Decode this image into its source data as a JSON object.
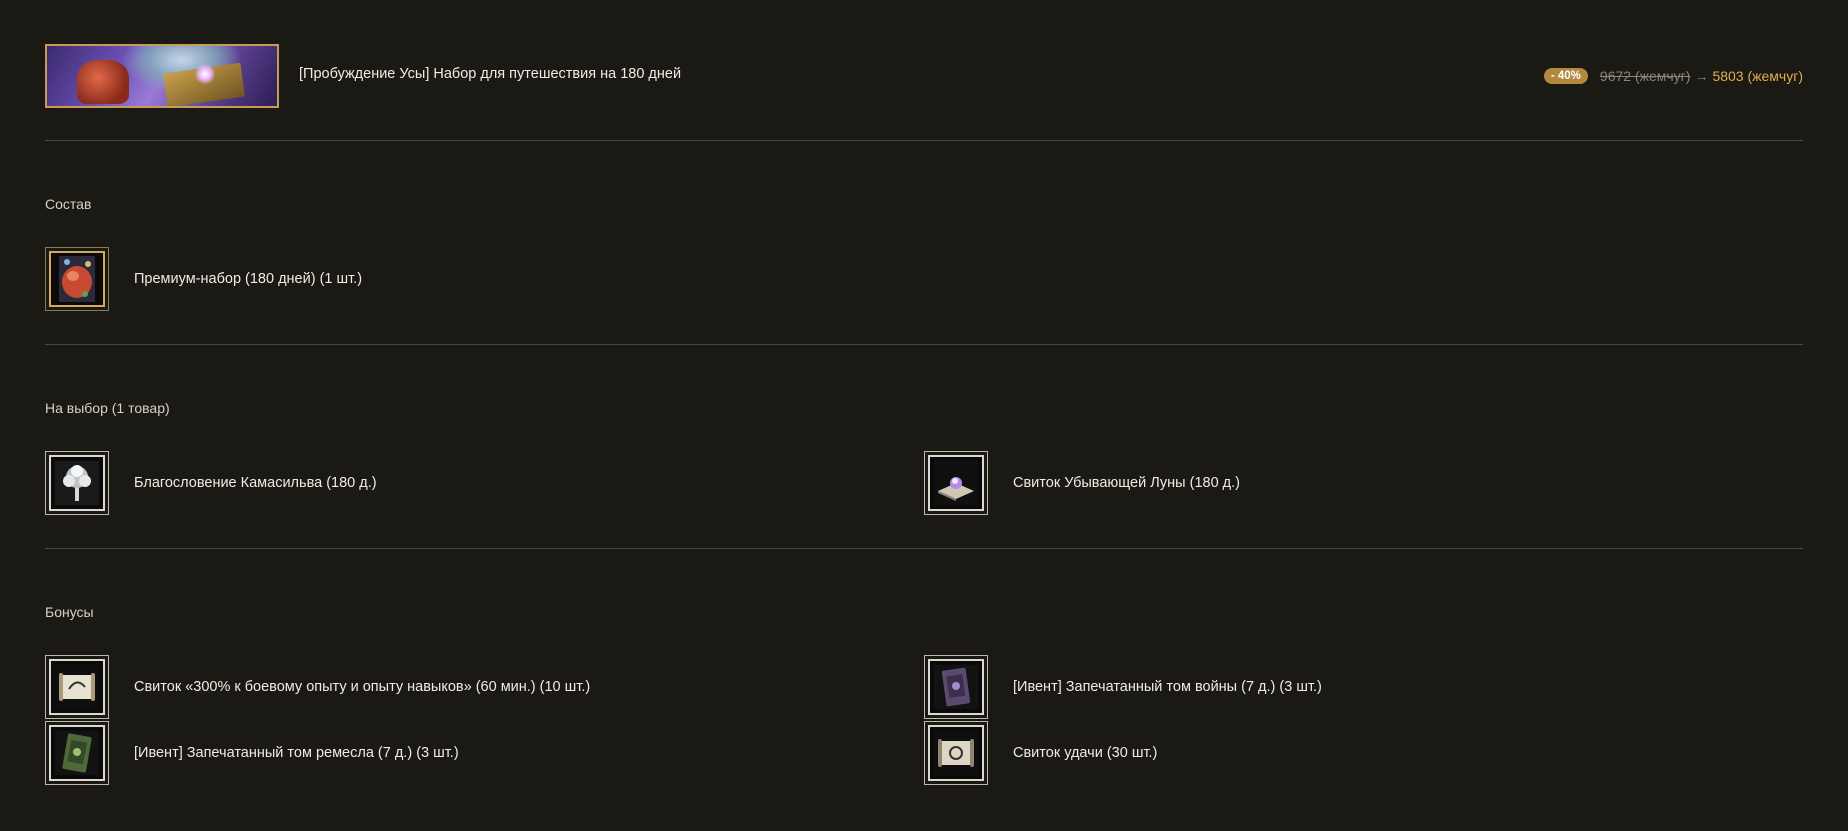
{
  "header": {
    "title": "[Пробуждение Усы] Набор для путешествия на 180 дней",
    "discount": "- 40%",
    "old_price": "9672 (жемчуг)",
    "arrow": "→",
    "new_price": "5803 (жемчуг)"
  },
  "composition": {
    "title": "Состав",
    "items": [
      {
        "label": "Премиум-набор (180 дней) (1 шт.)",
        "icon": "premium-bag-icon"
      }
    ]
  },
  "choice": {
    "title": "На выбор (1 товар)",
    "items": [
      {
        "label": "Благословение Камасильва (180 д.)",
        "icon": "silver-tree-icon"
      },
      {
        "label": "Свиток Убывающей Луны (180 д.)",
        "icon": "moon-scroll-icon"
      }
    ]
  },
  "bonuses": {
    "title": "Бонусы",
    "items": [
      {
        "label": "Свиток «300% к боевому опыту и опыту навыков» (60 мин.) (10 шт.)",
        "icon": "scroll-icon"
      },
      {
        "label": "[Ивент] Запечатанный том войны (7 д.) (3 шт.)",
        "icon": "war-tome-icon"
      },
      {
        "label": "[Ивент] Запечатанный том ремесла (7 д.) (3 шт.)",
        "icon": "craft-tome-icon"
      },
      {
        "label": "Свиток удачи (30 шт.)",
        "icon": "luck-scroll-icon"
      }
    ]
  },
  "colors": {
    "background": "#1b1913",
    "accent_gold": "#e2ac52",
    "badge": "#b4893d",
    "divider": "#4a4740"
  }
}
